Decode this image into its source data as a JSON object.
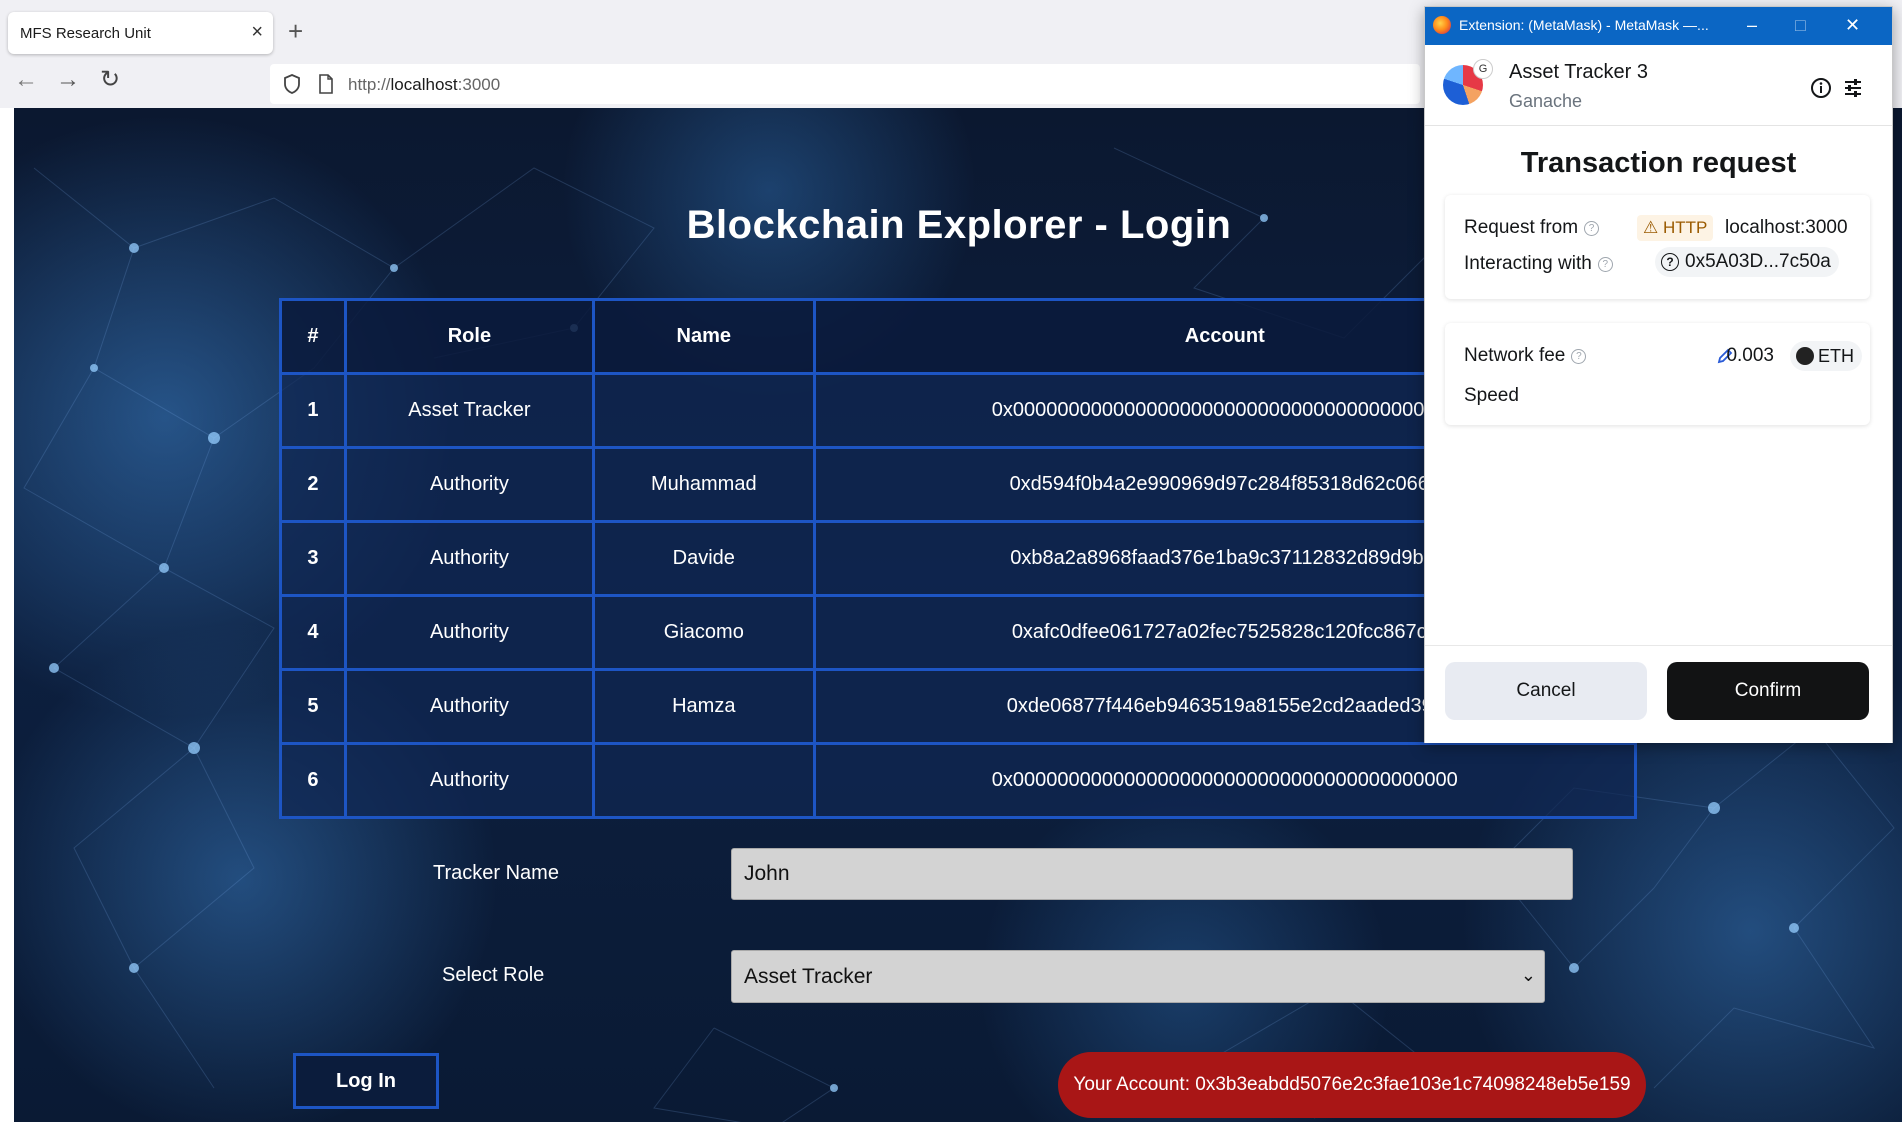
{
  "browser": {
    "tab_title": "MFS Research Unit",
    "tab_close": "×",
    "new_tab": "+",
    "url_prefix": "http://",
    "url_host": "localhost",
    "url_port": ":3000",
    "back": "←",
    "forward": "→",
    "reload": "↻"
  },
  "page": {
    "title": "Blockchain Explorer - Login",
    "table": {
      "headers": [
        "#",
        "Role",
        "Name",
        "Account"
      ],
      "rows": [
        {
          "num": "1",
          "role": "Asset Tracker",
          "name": "",
          "account": "0x0000000000000000000000000000000000000000"
        },
        {
          "num": "2",
          "role": "Authority",
          "name": "Muhammad",
          "account": "0xd594f0b4a2e990969d97c284f85318d62c066e"
        },
        {
          "num": "3",
          "role": "Authority",
          "name": "Davide",
          "account": "0xb8a2a8968faad376e1ba9c37112832d89d9bcf"
        },
        {
          "num": "4",
          "role": "Authority",
          "name": "Giacomo",
          "account": "0xafc0dfee061727a02fec7525828c120fcc867c0"
        },
        {
          "num": "5",
          "role": "Authority",
          "name": "Hamza",
          "account": "0xde06877f446eb9463519a8155e2cd2aaded39c"
        },
        {
          "num": "6",
          "role": "Authority",
          "name": "",
          "account": "0x0000000000000000000000000000000000000000"
        }
      ]
    },
    "form": {
      "tracker_label": "Tracker Name",
      "tracker_value": "John",
      "role_label": "Select Role",
      "role_value": "Asset Tracker",
      "login_button": "Log In"
    },
    "account_banner": "Your Account: 0x3b3eabdd5076e2c3fae103e1c74098248eb5e159"
  },
  "metamask": {
    "window_title": "Extension: (MetaMask) - MetaMask —...",
    "account_name": "Asset Tracker 3",
    "network_name": "Ganache",
    "avatar_badge": "G",
    "heading": "Transaction request",
    "request_from_label": "Request from",
    "http_badge": "⚠ HTTP",
    "origin": "localhost:3000",
    "interacting_label": "Interacting with",
    "contract_address": "0x5A03D...7c50a",
    "network_fee_label": "Network fee",
    "fee_amount": "0.003",
    "fee_unit": "ETH",
    "speed_label": "Speed",
    "cancel_button": "Cancel",
    "confirm_button": "Confirm"
  }
}
